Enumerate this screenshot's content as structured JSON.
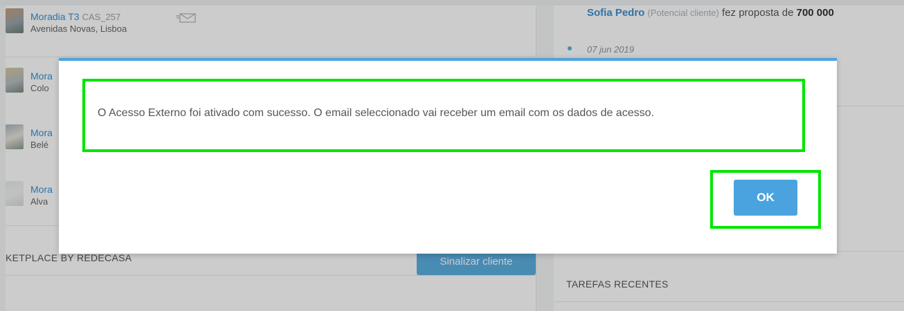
{
  "left_panel": {
    "properties": [
      {
        "title": "Moradia T3",
        "code": "CAS_257",
        "location": "Avenidas Novas, Lisboa"
      },
      {
        "title": "Mora",
        "code": "",
        "location": "Colo"
      },
      {
        "title": "Mora",
        "code": "",
        "location": "Belé"
      },
      {
        "title": "Mora",
        "code": "",
        "location": "Alva"
      }
    ],
    "section_title": "KETPLACE BY REDECASA",
    "flag_button": "Sinalizar cliente"
  },
  "right_panel": {
    "activity": {
      "name": "Sofia Pedro",
      "tag": "(Potencial cliente)",
      "text": "fez proposta de",
      "amount": "700 000"
    },
    "date": "07 jun 2019",
    "section_title": "TAREFAS RECENTES"
  },
  "dialog": {
    "message": "O Acesso Externo foi ativado com sucesso. O email seleccionado vai receber um email com os dados de acesso.",
    "ok_label": "OK"
  },
  "colors": {
    "accent": "#4aa3df",
    "highlight_frame": "#00e600",
    "overlay": "rgba(0,0,0,0.20)"
  }
}
